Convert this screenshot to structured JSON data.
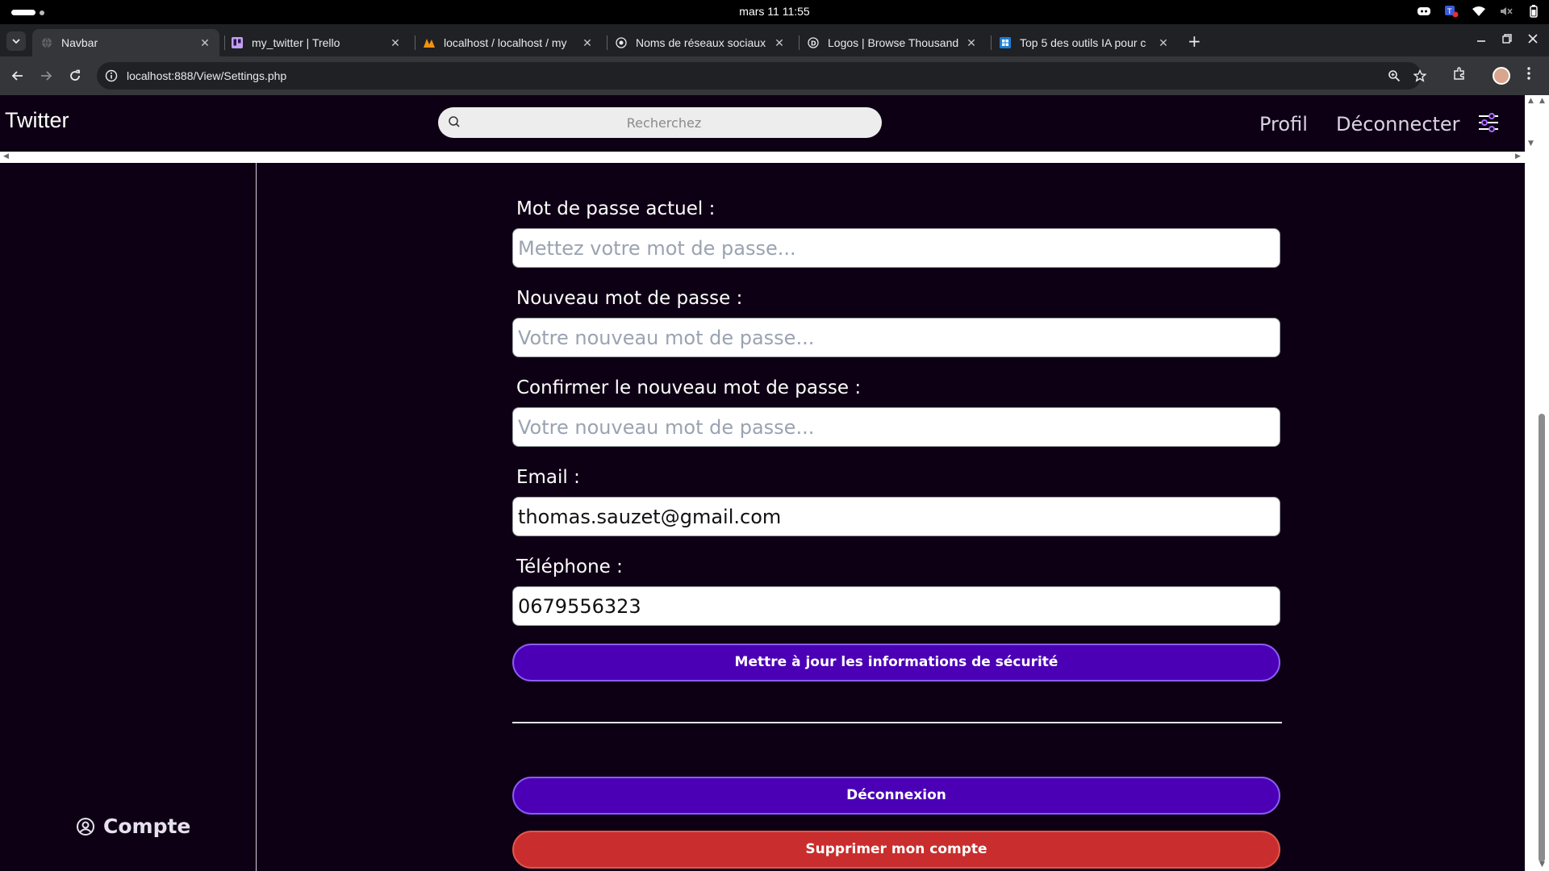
{
  "os": {
    "clock": "mars 11  11:55"
  },
  "browser": {
    "tabs": [
      {
        "title": "Navbar",
        "icon": "globe-icon",
        "active": true
      },
      {
        "title": "my_twitter | Trello",
        "icon": "trello-icon",
        "active": false
      },
      {
        "title": "localhost / localhost / my",
        "icon": "phpmyadmin-icon",
        "active": false
      },
      {
        "title": "Noms de réseaux sociaux",
        "icon": "globe-icon",
        "active": false
      },
      {
        "title": "Logos | Browse Thousand",
        "icon": "dribbble-icon",
        "active": false
      },
      {
        "title": "Top 5 des outils IA pour c",
        "icon": "site-icon",
        "active": false
      }
    ],
    "url": "localhost:888/View/Settings.php"
  },
  "navbar": {
    "brand": "Twitter",
    "search_placeholder": "Recherchez",
    "profil": "Profil",
    "deconnecter": "Déconnecter"
  },
  "sidebar": {
    "compte": "Compte"
  },
  "form": {
    "current_password_label": "Mot de passe actuel :",
    "current_password_placeholder": "Mettez votre mot de passe...",
    "new_password_label": "Nouveau mot de passe :",
    "new_password_placeholder": "Votre nouveau mot de passe...",
    "confirm_password_label": "Confirmer le nouveau mot de passe :",
    "confirm_password_placeholder": "Votre nouveau mot de passe...",
    "email_label": "Email :",
    "email_value": "thomas.sauzet@gmail.com",
    "phone_label": "Téléphone :",
    "phone_value": "0679556323",
    "update_button": "Mettre à jour les informations de sécurité",
    "logout_button": "Déconnexion",
    "delete_button": "Supprimer mon compte"
  },
  "colors": {
    "page_bg": "#0e0014",
    "primary_button": "#4b00b6",
    "danger_button": "#c92d2d"
  }
}
